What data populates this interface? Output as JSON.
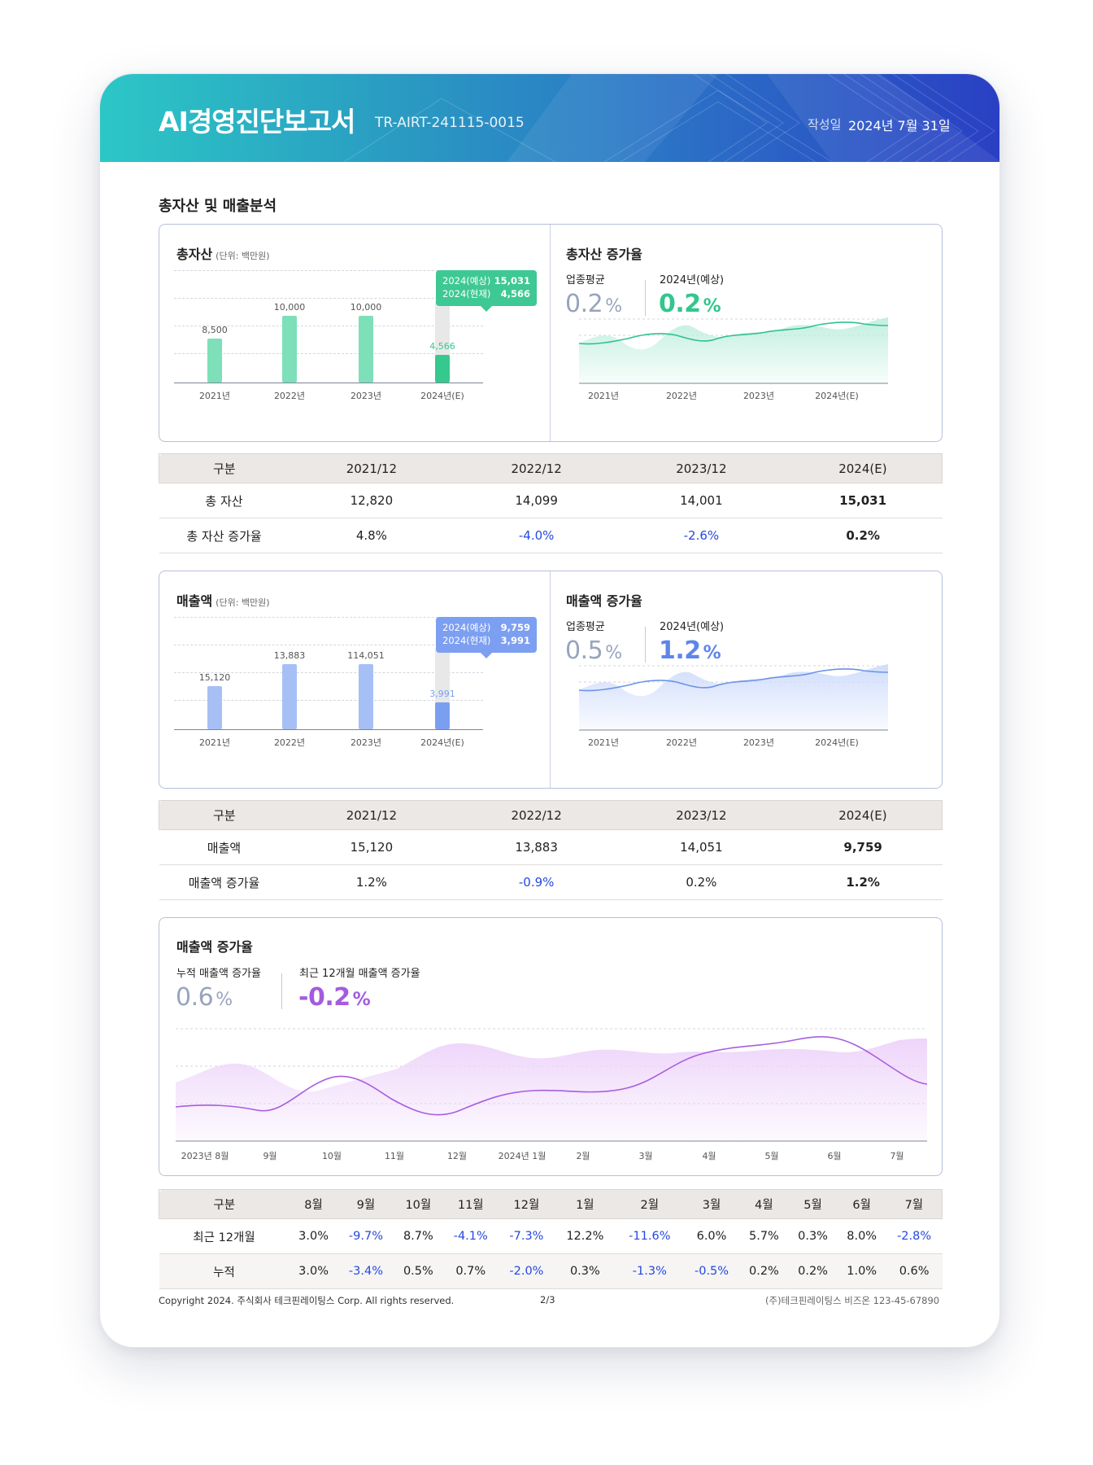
{
  "header": {
    "title": "AI경영진단보고서",
    "code": "TR-AIRT-241115-0015",
    "date_label": "작성일",
    "date": "2024년 7월 31일"
  },
  "section": {
    "title": "총자산 및 매출분석"
  },
  "asset": {
    "title": "총자산",
    "unit": "(단위: 백만원)",
    "tooltip": {
      "forecast_label": "2024(예상)",
      "forecast_value": "15,031",
      "current_label": "2024(현재)",
      "current_value": "4,566"
    },
    "growth": {
      "title": "총자산 증가율",
      "industry_label": "업종평균",
      "industry_value": "0.2",
      "forecast_label": "2024년(예상)",
      "forecast_value": "0.2",
      "pct": "%"
    },
    "table": {
      "headers": [
        "구분",
        "2021/12",
        "2022/12",
        "2023/12",
        "2024(E)"
      ],
      "rows": [
        [
          "총 자산",
          "12,820",
          "14,099",
          "14,001",
          "15,031"
        ],
        [
          "총 자산 증가율",
          "4.8%",
          "-4.0%",
          "-2.6%",
          "0.2%"
        ]
      ]
    }
  },
  "sales": {
    "title": "매출액",
    "unit": "(단위: 백만원)",
    "tooltip": {
      "forecast_label": "2024(예상)",
      "forecast_value": "9,759",
      "current_label": "2024(현재)",
      "current_value": "3,991"
    },
    "growth": {
      "title": "매출액 증가율",
      "industry_label": "업종평균",
      "industry_value": "0.5",
      "forecast_label": "2024년(예상)",
      "forecast_value": "1.2",
      "pct": "%"
    },
    "table": {
      "headers": [
        "구분",
        "2021/12",
        "2022/12",
        "2023/12",
        "2024(E)"
      ],
      "rows": [
        [
          "매출액",
          "15,120",
          "13,883",
          "14,051",
          "9,759"
        ],
        [
          "매출액 증가율",
          "1.2%",
          "-0.9%",
          "0.2%",
          "1.2%"
        ]
      ]
    }
  },
  "monthly": {
    "title": "매출액 증가율",
    "cumulative_label": "누적 매출액 증가율",
    "cumulative_value": "0.6",
    "recent_label": "최근 12개월 매출액 증가율",
    "recent_value": "-0.2",
    "pct": "%",
    "table": {
      "headers": [
        "구분",
        "8월",
        "9월",
        "10월",
        "11월",
        "12월",
        "1월",
        "2월",
        "3월",
        "4월",
        "5월",
        "6월",
        "7월"
      ],
      "rows": [
        [
          "최근 12개월",
          "3.0%",
          "-9.7%",
          "8.7%",
          "-4.1%",
          "-7.3%",
          "12.2%",
          "-11.6%",
          "6.0%",
          "5.7%",
          "0.3%",
          "8.0%",
          "-2.8%"
        ],
        [
          "누적",
          "3.0%",
          "-3.4%",
          "0.5%",
          "0.7%",
          "-2.0%",
          "0.3%",
          "-1.3%",
          "-0.5%",
          "0.2%",
          "0.2%",
          "1.0%",
          "0.6%"
        ]
      ]
    }
  },
  "chart_data": [
    {
      "type": "bar",
      "title": "총자산",
      "categories": [
        "2021년",
        "2022년",
        "2023년",
        "2024년(E)"
      ],
      "values": [
        8500,
        10000,
        10000,
        4566
      ],
      "value_labels": [
        "8,500",
        "10,000",
        "10,000",
        "4,566"
      ],
      "forecast_total": 15031,
      "ylim": [
        0,
        16000
      ],
      "colors": {
        "bar": "#7de0b8",
        "current": "#36c98d",
        "forecast": "#e8e8e8"
      }
    },
    {
      "type": "area",
      "title": "총자산 증가율",
      "x": [
        "2021년",
        "2022년",
        "2023년",
        "2024년(E)"
      ],
      "series": [
        {
          "values": [
            0.22,
            0.31,
            0.19,
            0.2,
            0.24,
            0.33,
            0.26,
            0.45
          ]
        },
        {
          "values": [
            0.27,
            0.2,
            0.18,
            0.3,
            0.17,
            0.24,
            0.15,
            0.5
          ]
        }
      ],
      "colors": {
        "line": "#2fc28e",
        "area": "#bfeede"
      }
    },
    {
      "type": "bar",
      "title": "매출액",
      "categories": [
        "2021년",
        "2022년",
        "2023년",
        "2024년(E)"
      ],
      "values": [
        15120,
        13883,
        114051,
        3991
      ],
      "value_labels": [
        "15,120",
        "13,883",
        "114,051",
        "3,991"
      ],
      "forecast_total": 9759,
      "colors": {
        "bar": "#a6c0f6",
        "current": "#7b9ff0",
        "forecast": "#e8e8e8"
      }
    },
    {
      "type": "area",
      "title": "매출액 증가율",
      "x": [
        "2021년",
        "2022년",
        "2023년",
        "2024년(E)"
      ],
      "colors": {
        "line": "#6b93e6",
        "area": "#cddbfb"
      }
    },
    {
      "type": "area",
      "title": "매출액 증가율",
      "x": [
        "2023년 8월",
        "9월",
        "10월",
        "11월",
        "12월",
        "2024년 1월",
        "2월",
        "3월",
        "4월",
        "5월",
        "6월",
        "7월"
      ],
      "colors": {
        "line": "#a85ee0",
        "area": "#eed5fa"
      }
    }
  ]
}
